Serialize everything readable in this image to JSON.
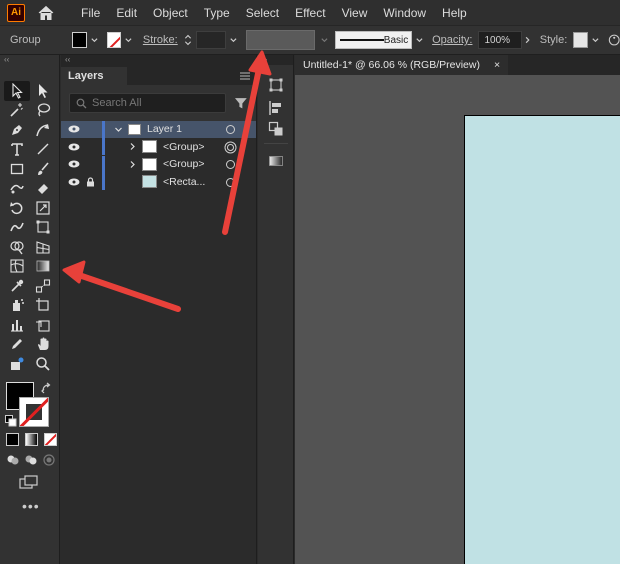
{
  "app": {
    "logo_text": "Ai"
  },
  "menu": [
    "File",
    "Edit",
    "Object",
    "Type",
    "Select",
    "Effect",
    "View",
    "Window",
    "Help"
  ],
  "control_bar": {
    "selection_label": "Group",
    "stroke_label": "Stroke:",
    "brush_label": "Basic",
    "opacity_label": "Opacity:",
    "opacity_value": "100%",
    "style_label": "Style:"
  },
  "layers_panel": {
    "tab_label": "Layers",
    "search_placeholder": "Search All",
    "rows": [
      {
        "name": "Layer 1",
        "selected": true,
        "expanded": true
      },
      {
        "name": "<Group>",
        "selected": false,
        "expanded": false
      },
      {
        "name": "<Group>",
        "selected": false,
        "expanded": false
      },
      {
        "name": "<Recta...",
        "selected": false,
        "locked": true
      }
    ]
  },
  "document": {
    "tab_title": "Untitled-1* @ 66.06 % (RGB/Preview)",
    "close_glyph": "×"
  },
  "colors": {
    "accent": "#4a76c9",
    "artboard_fill": "#c0e1e4",
    "annotation_arrow": "#e8413a"
  }
}
